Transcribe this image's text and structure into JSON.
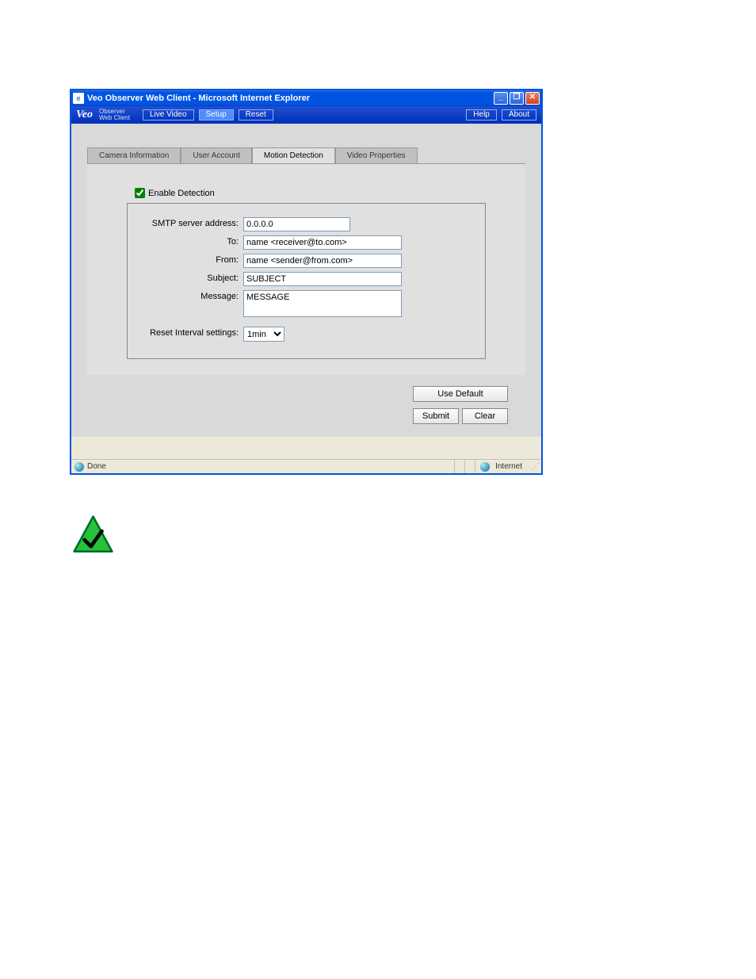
{
  "window": {
    "title": "Veo Observer Web Client - Microsoft Internet Explorer"
  },
  "topbar": {
    "logo": "Veo",
    "logo_sub1": "Observer",
    "logo_sub2": "Web Client",
    "live_video": "Live Video",
    "setup": "Setup",
    "reset": "Reset",
    "help": "Help",
    "about": "About"
  },
  "tabs": {
    "camera_info": "Camera Information",
    "user_account": "User Account",
    "motion_detection": "Motion Detection",
    "video_properties": "Video Properties"
  },
  "form": {
    "enable_label": "Enable Detection",
    "smtp_label": "SMTP server address:",
    "smtp_value": "0.0.0.0",
    "to_label": "To:",
    "to_value": "name <receiver@to.com>",
    "from_label": "From:",
    "from_value": "name <sender@from.com>",
    "subject_label": "Subject:",
    "subject_value": "SUBJECT",
    "message_label": "Message:",
    "message_value": "MESSAGE",
    "reset_interval_label": "Reset Interval settings:",
    "reset_interval_value": "1min"
  },
  "actions": {
    "use_default": "Use Default",
    "submit": "Submit",
    "clear": "Clear"
  },
  "status": {
    "done": "Done",
    "zone": "Internet"
  }
}
